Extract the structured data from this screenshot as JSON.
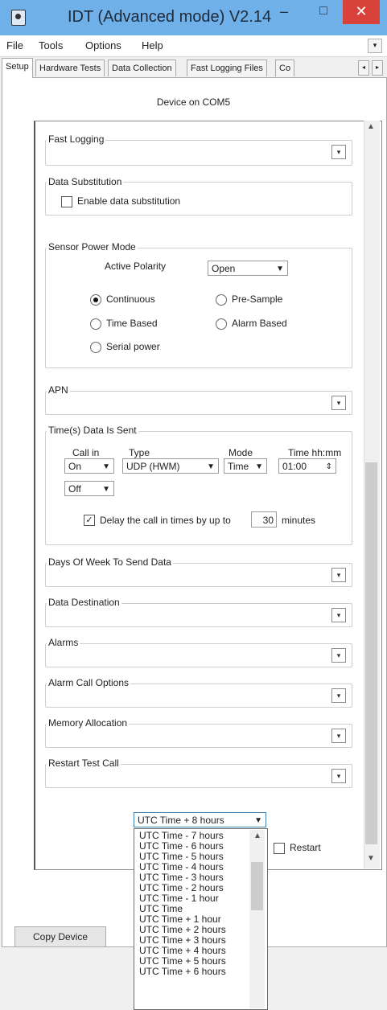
{
  "window": {
    "title": "IDT (Advanced mode) V2.14",
    "minimize": "–",
    "maximize": "□",
    "close": "✕"
  },
  "menu": {
    "items": [
      "File",
      "Tools",
      "Options",
      "Help"
    ],
    "overflow": "▾"
  },
  "tabs": {
    "items": [
      "Setup",
      "Hardware Tests",
      "Data Collection",
      "Fast Logging Files",
      "Co"
    ],
    "active": "Setup",
    "scroll_left": "◂",
    "scroll_right": "▸"
  },
  "device_label": "Device on COM5",
  "fast_logging": {
    "title": "Fast Logging",
    "expand": "▾"
  },
  "data_substitution": {
    "title": "Data Substitution",
    "checkbox_label": "Enable data substitution",
    "checked": false
  },
  "sensor_power": {
    "title": "Sensor Power Mode",
    "polarity_label": "Active Polarity",
    "polarity_value": "Open",
    "options": {
      "continuous": "Continuous",
      "pre_sample": "Pre-Sample",
      "time_based": "Time Based",
      "alarm_based": "Alarm Based",
      "serial_power": "Serial power"
    },
    "selected": "Continuous"
  },
  "apn": {
    "title": "APN",
    "expand": "▾"
  },
  "times_sent": {
    "title": "Time(s) Data Is Sent",
    "col_call_in": "Call in",
    "col_type": "Type",
    "col_mode": "Mode",
    "col_time": "Time hh:mm",
    "row1": {
      "call_in": "On",
      "type": "UDP (HWM)",
      "mode": "Time",
      "time": "01:00"
    },
    "row2": {
      "call_in": "Off"
    },
    "delay_label_pre": "Delay the call in times by up to",
    "delay_value": "30",
    "delay_label_post": "minutes",
    "delay_checked": true
  },
  "sections": {
    "days": "Days Of Week To Send Data",
    "destination": "Data Destination",
    "alarms": "Alarms",
    "alarm_call": "Alarm Call Options",
    "memory": "Memory Allocation",
    "restart_test": "Restart Test Call"
  },
  "timezone": {
    "value": "UTC Time + 8 hours",
    "options": [
      "UTC Time - 7 hours",
      "UTC Time - 6 hours",
      "UTC Time - 5 hours",
      "UTC Time - 4 hours",
      "UTC Time - 3 hours",
      "UTC Time - 2 hours",
      "UTC Time - 1 hour",
      "UTC Time",
      "UTC Time + 1 hour",
      "UTC Time + 2 hours",
      "UTC Time + 3 hours",
      "UTC Time + 4 hours",
      "UTC Time + 5 hours",
      "UTC Time + 6 hours"
    ]
  },
  "restart": {
    "label": "Restart",
    "checked": false
  },
  "copy_device": "Copy Device",
  "icons": {
    "expand": "chevron-down-icon",
    "scroll_up": "▲",
    "scroll_down": "▼"
  }
}
